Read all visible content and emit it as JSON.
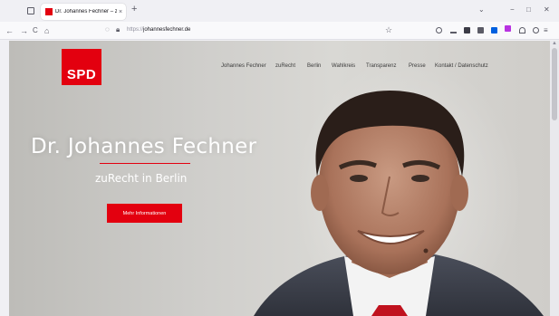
{
  "browser": {
    "tab_title": "Dr. Johannes Fechner – zuRecht",
    "tab_close": "×",
    "new_tab": "+",
    "url_protocol": "https://",
    "url_domain": "johannesfechner.de",
    "controls": {
      "dropdown": "⌄",
      "minimize": "−",
      "maximize": "□",
      "close": "✕"
    },
    "nav": {
      "back": "←",
      "forward": "→",
      "reload": "C",
      "home": "⌂"
    }
  },
  "site": {
    "logo": "SPD",
    "nav": [
      "Johannes Fechner",
      "zuRecht",
      "Berlin",
      "Wahlkreis",
      "Transparenz",
      "Presse",
      "Kontakt / Datenschutz"
    ],
    "hero_title": "Dr. Johannes Fechner",
    "hero_subtitle": "zuRecht in Berlin",
    "cta_label": "Mehr Informationen"
  },
  "colors": {
    "accent": "#e3000f"
  }
}
